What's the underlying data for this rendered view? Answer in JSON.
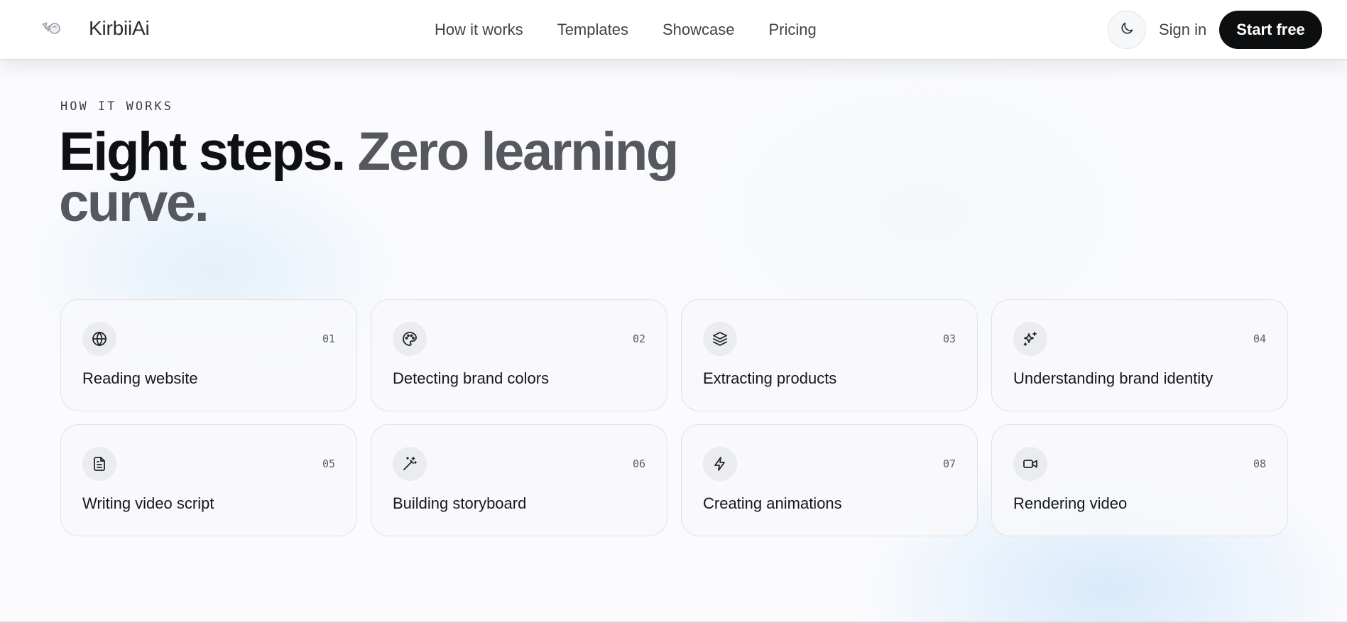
{
  "brand": {
    "name": "KirbiiAi",
    "logo_icon": "sparkle-logo-icon"
  },
  "nav": {
    "items": [
      "How it works",
      "Templates",
      "Showcase",
      "Pricing"
    ]
  },
  "actions": {
    "theme_toggle_icon": "moon-icon",
    "sign_in": "Sign in",
    "start_free": "Start free"
  },
  "hero": {
    "eyebrow": "HOW IT WORKS",
    "headline_dark": "Eight steps.",
    "headline_muted": "Zero learning curve."
  },
  "steps": [
    {
      "num": "01",
      "label": "Reading website",
      "icon": "globe-icon"
    },
    {
      "num": "02",
      "label": "Detecting brand colors",
      "icon": "palette-icon"
    },
    {
      "num": "03",
      "label": "Extracting products",
      "icon": "layers-icon"
    },
    {
      "num": "04",
      "label": "Understanding brand identity",
      "icon": "sparkles-icon"
    },
    {
      "num": "05",
      "label": "Writing video script",
      "icon": "document-icon"
    },
    {
      "num": "06",
      "label": "Building storyboard",
      "icon": "magic-wand-icon"
    },
    {
      "num": "07",
      "label": "Creating animations",
      "icon": "lightning-icon"
    },
    {
      "num": "08",
      "label": "Rendering video",
      "icon": "video-camera-icon"
    }
  ],
  "colors": {
    "primary_button": "#0d0e10",
    "headline_dark": "#0e1014",
    "headline_muted": "#55585e"
  }
}
